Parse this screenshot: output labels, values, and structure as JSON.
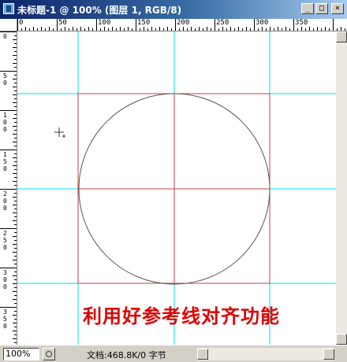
{
  "window": {
    "title": "未标题-1 @ 100% (图层 1, RGB/8)",
    "controls": {
      "minimize": "_",
      "maximize": "□",
      "close": "×"
    }
  },
  "ruler": {
    "top_labels": [
      "0",
      "50",
      "100",
      "150",
      "200",
      "250",
      "300",
      "350"
    ],
    "left_labels": [
      "0",
      "5\n0",
      "1\n0\n0",
      "1\n5\n0",
      "2\n0\n0",
      "2\n5\n0",
      "3\n0\n0",
      "3\n5\n0"
    ]
  },
  "canvas": {
    "caption": "利用好参考线对齐功能",
    "guide_color": "#00e0e0",
    "circle_color": "#555555",
    "square_color": "#c04040",
    "caption_color": "#e00000"
  },
  "status": {
    "zoom": "100%",
    "doc_info": "文档:468.8K/0 字节"
  }
}
